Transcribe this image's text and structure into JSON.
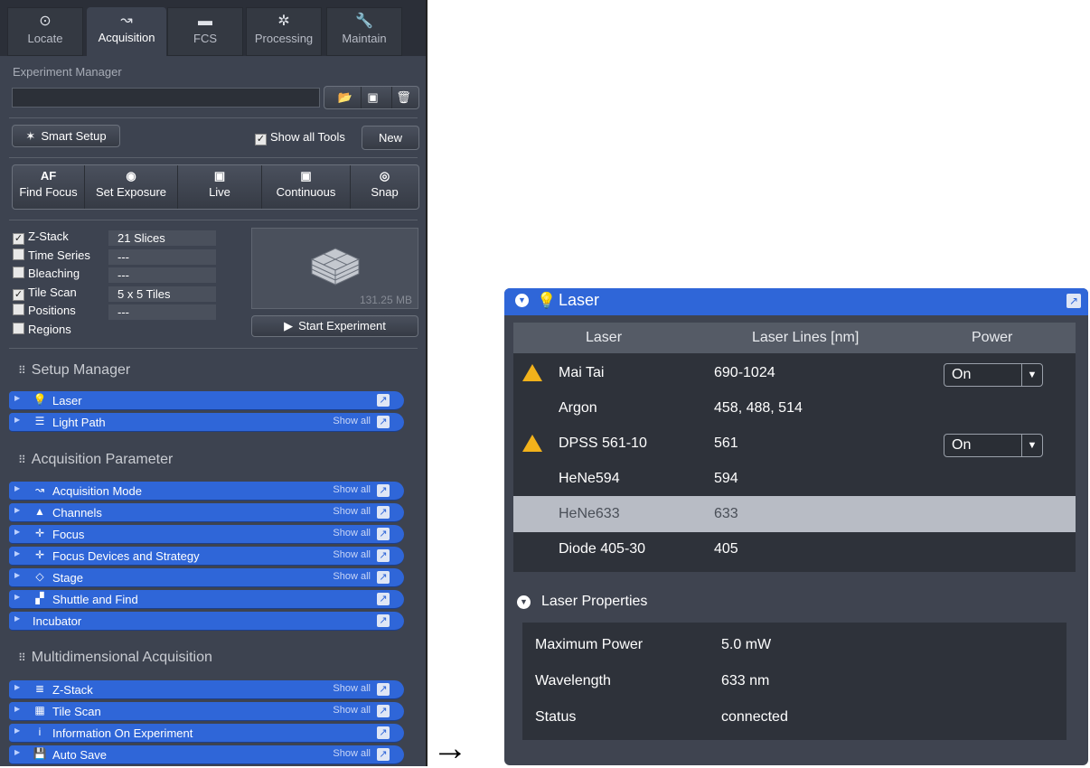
{
  "tabs": [
    {
      "label": "Locate",
      "icon": "locate-icon",
      "glyph": "⊙",
      "active": false
    },
    {
      "label": "Acquisition",
      "icon": "acquisition-icon",
      "glyph": "↝",
      "active": true
    },
    {
      "label": "FCS",
      "icon": "fcs-icon",
      "glyph": "▬",
      "active": false
    },
    {
      "label": "Processing",
      "icon": "processing-icon",
      "glyph": "✲",
      "active": false
    },
    {
      "label": "Maintain",
      "icon": "maintain-icon",
      "glyph": "🔧",
      "active": false
    }
  ],
  "experiment": {
    "label": "Experiment Manager",
    "name_value": "",
    "smart_setup": "Smart Setup",
    "show_all_tools": "Show all Tools",
    "show_all_tools_checked": true,
    "new_label": "New"
  },
  "toolbar": [
    {
      "glyph": "AF",
      "label": "Find Focus",
      "name": "find-focus-button"
    },
    {
      "glyph": "◉",
      "label": "Set Exposure",
      "name": "set-exposure-button"
    },
    {
      "glyph": "▣",
      "label": "Live",
      "name": "live-button"
    },
    {
      "glyph": "▣",
      "label": "Continuous",
      "name": "continuous-button"
    },
    {
      "glyph": "◎",
      "label": "Snap",
      "name": "snap-button"
    }
  ],
  "dimensions": [
    {
      "label": "Z-Stack",
      "checked": true,
      "value": "21 Slices"
    },
    {
      "label": "Time Series",
      "checked": false,
      "value": "---"
    },
    {
      "label": "Bleaching",
      "checked": false,
      "value": "---"
    },
    {
      "label": "Tile Scan",
      "checked": true,
      "value": "5 x 5 Tiles"
    },
    {
      "label": "Positions",
      "checked": false,
      "value": "---"
    },
    {
      "label": "Regions",
      "checked": false,
      "value": ""
    }
  ],
  "preview_size": "131.25 MB",
  "start_experiment": "Start Experiment",
  "sections": {
    "setup_manager": "Setup Manager",
    "acquisition_parameter": "Acquisition Parameter",
    "multidimensional": "Multidimensional Acquisition"
  },
  "show_all_label": "Show all",
  "setup_tools": [
    {
      "label": "Laser",
      "glyph": "💡",
      "show_all": false
    },
    {
      "label": "Light Path",
      "glyph": "☰",
      "show_all": true
    }
  ],
  "acq_tools": [
    {
      "label": "Acquisition Mode",
      "glyph": "↝",
      "show_all": true
    },
    {
      "label": "Channels",
      "glyph": "▲",
      "show_all": true
    },
    {
      "label": "Focus",
      "glyph": "✛",
      "show_all": true
    },
    {
      "label": "Focus Devices and Strategy",
      "glyph": "✛",
      "show_all": true
    },
    {
      "label": "Stage",
      "glyph": "◇",
      "show_all": true
    },
    {
      "label": "Shuttle and Find",
      "glyph": "▞",
      "show_all": false
    },
    {
      "label": "Incubator",
      "glyph": "",
      "show_all": false
    }
  ],
  "multi_tools": [
    {
      "label": "Z-Stack",
      "glyph": "≣",
      "show_all": true
    },
    {
      "label": "Tile Scan",
      "glyph": "▦",
      "show_all": true
    },
    {
      "label": "Information On Experiment",
      "glyph": "i",
      "show_all": false
    },
    {
      "label": "Auto Save",
      "glyph": "💾",
      "show_all": true
    }
  ],
  "arrow": "→",
  "laser_panel": {
    "title": "Laser",
    "columns": [
      "Laser",
      "Laser Lines [nm]",
      "Power"
    ],
    "rows": [
      {
        "name": "Mai Tai",
        "lines": "690-1024",
        "power": "On",
        "warning": true,
        "selected": false
      },
      {
        "name": "Argon",
        "lines": "458, 488, 514",
        "power": "",
        "warning": false,
        "selected": false
      },
      {
        "name": "DPSS 561-10",
        "lines": "561",
        "power": "On",
        "warning": true,
        "selected": false
      },
      {
        "name": "HeNe594",
        "lines": "594",
        "power": "",
        "warning": false,
        "selected": false
      },
      {
        "name": "HeNe633",
        "lines": "633",
        "power": "",
        "warning": false,
        "selected": true
      },
      {
        "name": "Diode 405-30",
        "lines": "405",
        "power": "",
        "warning": false,
        "selected": false
      }
    ],
    "properties_title": "Laser Properties",
    "properties": [
      {
        "key": "Maximum Power",
        "value": "5.0 mW"
      },
      {
        "key": "Wavelength",
        "value": "633 nm"
      },
      {
        "key": "Status",
        "value": "connected"
      }
    ]
  },
  "colors": {
    "accent": "#2f66d8",
    "panel": "#3d4350",
    "selected_row": "#b8bcc5"
  }
}
